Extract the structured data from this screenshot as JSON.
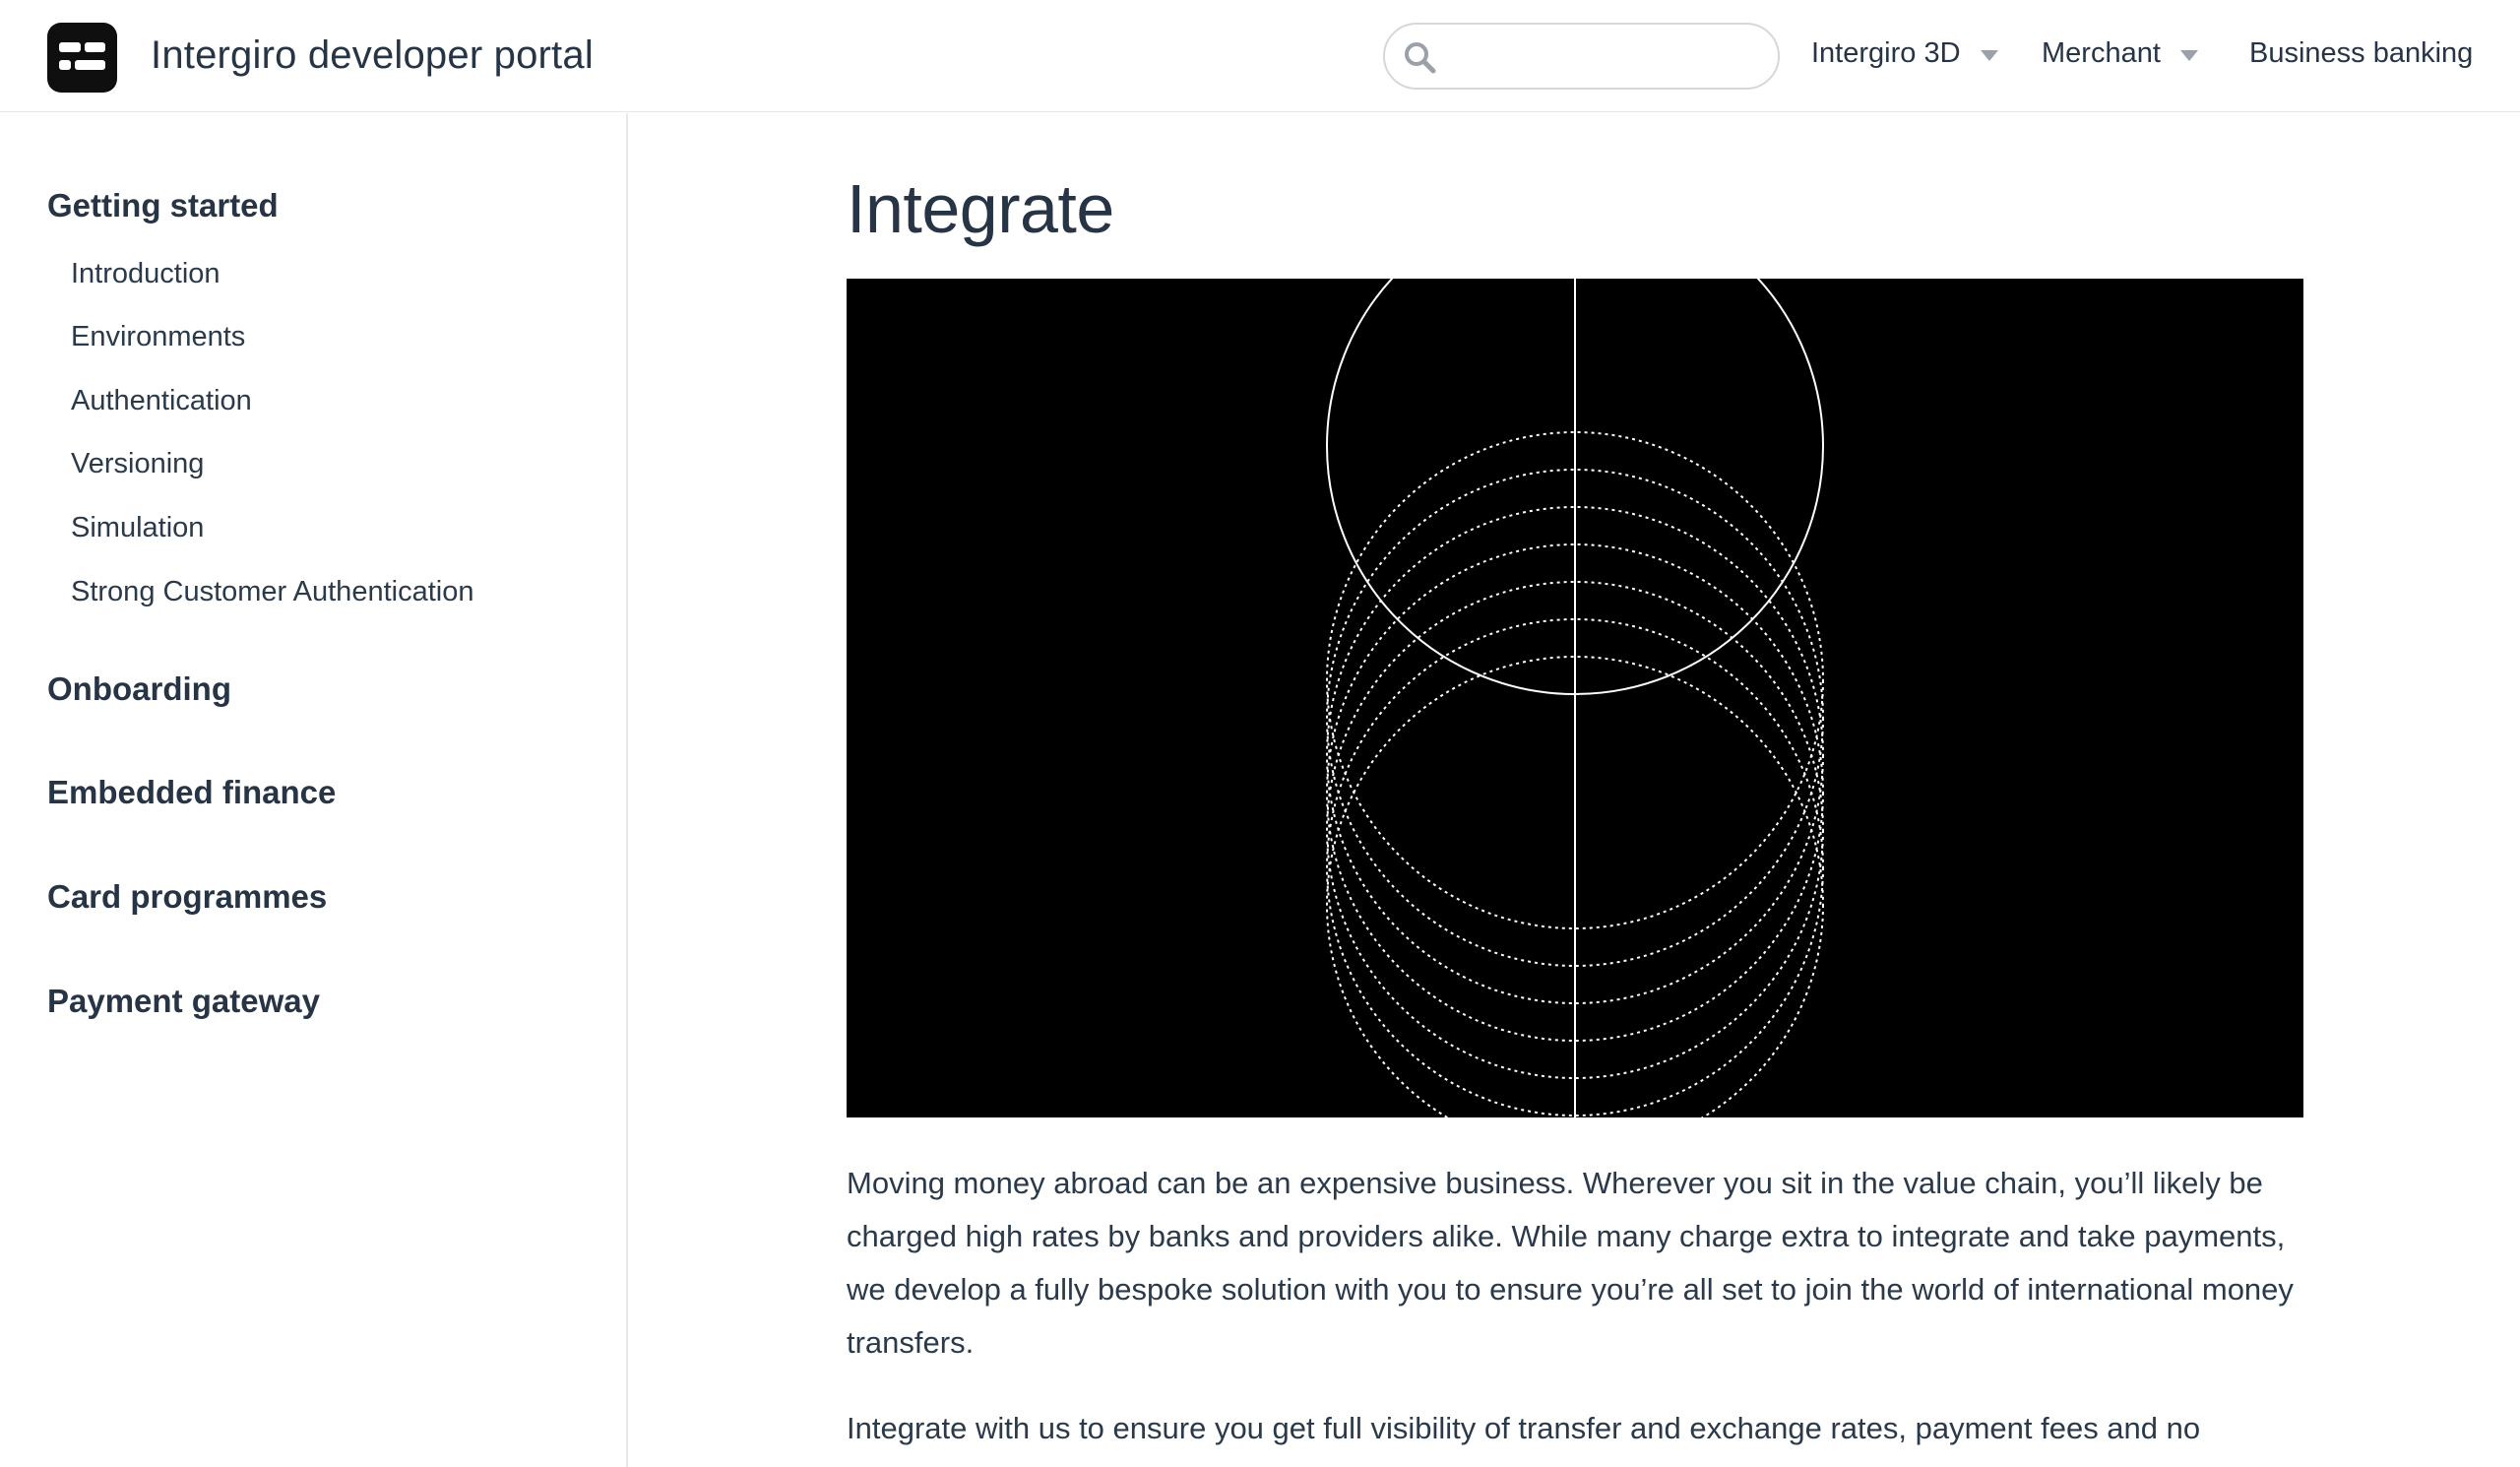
{
  "header": {
    "site_title": "Intergiro developer portal",
    "search_placeholder": "",
    "nav": [
      {
        "label": "Intergiro 3D",
        "has_dropdown": true
      },
      {
        "label": "Merchant",
        "has_dropdown": true
      },
      {
        "label": "Business banking",
        "has_dropdown": false
      }
    ]
  },
  "sidebar": {
    "getting_started": {
      "title": "Getting started",
      "items": [
        "Introduction",
        "Environments",
        "Authentication",
        "Versioning",
        "Simulation",
        "Strong Customer Authentication"
      ]
    },
    "sections": [
      "Onboarding",
      "Embedded finance",
      "Card programmes",
      "Payment gateway"
    ]
  },
  "main": {
    "title": "Integrate",
    "paragraphs": [
      "Moving money abroad can be an expensive business. Wherever you sit in the value chain, you’ll likely be charged high rates by banks and providers alike. While many charge extra to integrate and take payments, we develop a fully bespoke solution with you to ensure you’re all set to join the world of international money transfers.",
      "Integrate with us to ensure you get full visibility of transfer and exchange rates, payment fees and no"
    ]
  },
  "colors": {
    "text": "#263445",
    "border": "#e6e8eb",
    "hero_bg": "#000000",
    "hero_lines": "#ffffff"
  }
}
